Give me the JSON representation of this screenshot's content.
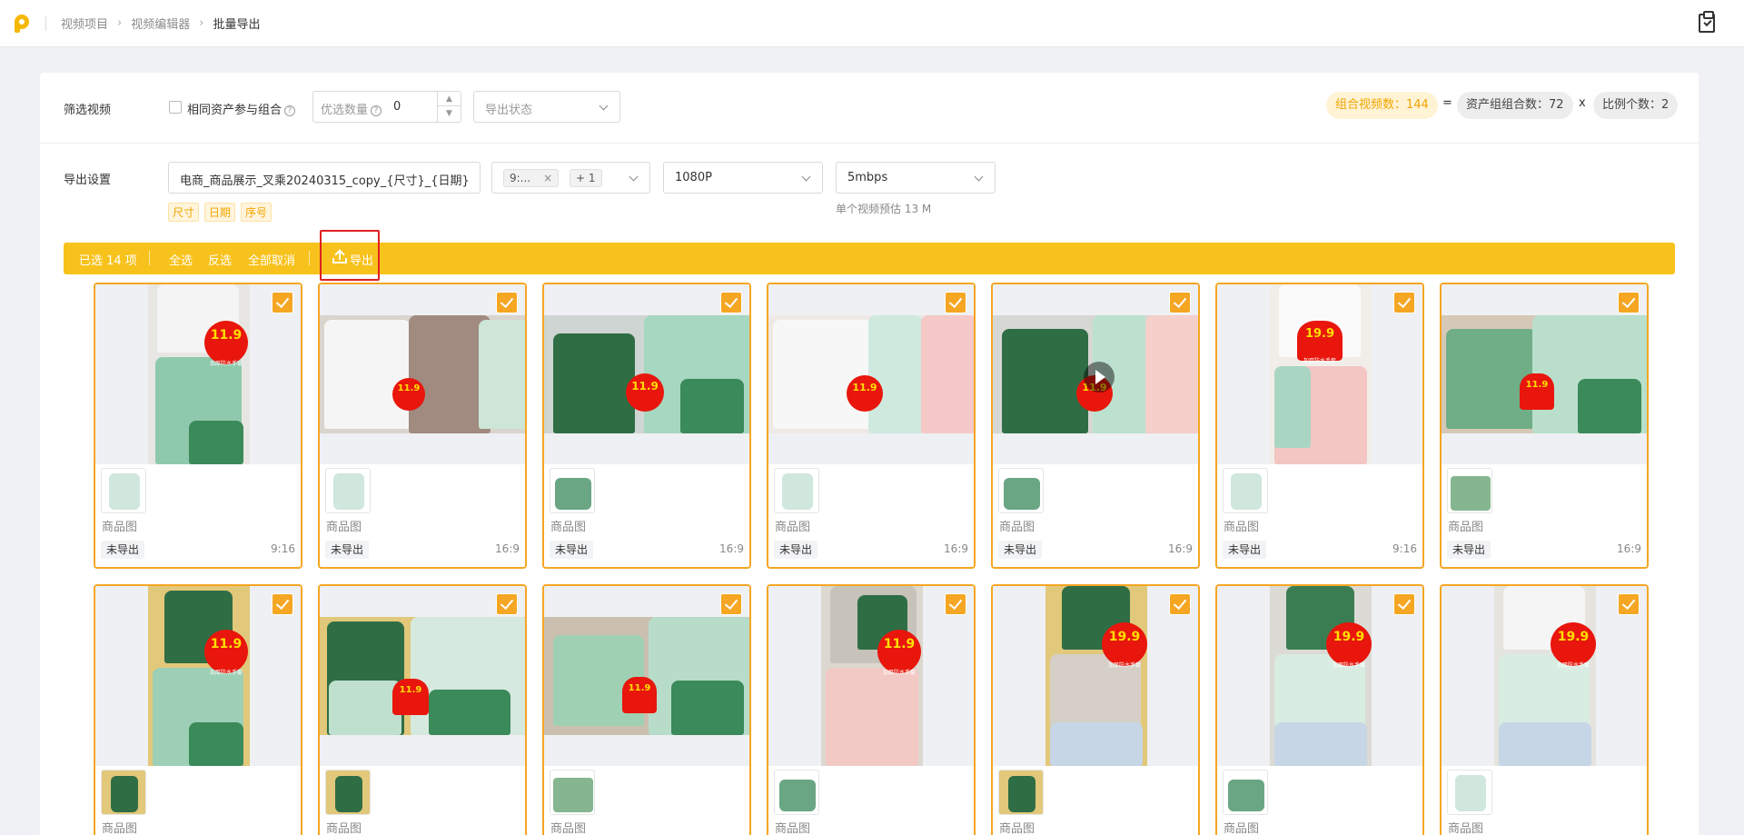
{
  "breadcrumb": [
    "视频项目",
    "视频编辑器",
    "批量导出"
  ],
  "filter": {
    "label": "筛选视频",
    "same_asset_label": "相同资产参与组合",
    "priority_placeholder": "优选数量",
    "priority_value": "0",
    "export_status_placeholder": "导出状态"
  },
  "summary": {
    "combo_videos": "组合视频数：144",
    "eq": "=",
    "asset_groups": "资产组组合数：72",
    "times": "x",
    "ratio_count": "比例个数：2"
  },
  "export_settings": {
    "label": "导出设置",
    "filename": "电商_商品展示_叉乘20240315_copy_{尺寸}_{日期}",
    "tags": [
      "尺寸",
      "日期",
      "序号"
    ],
    "ratio_tag": "9:...",
    "ratio_more": "+ 1",
    "resolution": "1080P",
    "bitrate": "5mbps",
    "estimate": "单个视频预估 13 M"
  },
  "toolbar": {
    "selected": "已选 14 项",
    "select_all": "全选",
    "invert": "反选",
    "cancel_all": "全部取消",
    "export": "导出"
  },
  "colors": {
    "accent": "#f8c21c",
    "card_border": "#f5a623",
    "highlight_box": "#e02020"
  },
  "cards": [
    {
      "label": "商品图",
      "status": "未导出",
      "ratio": "9:16",
      "price": "11.9"
    },
    {
      "label": "商品图",
      "status": "未导出",
      "ratio": "16:9",
      "price": "11.9"
    },
    {
      "label": "商品图",
      "status": "未导出",
      "ratio": "16:9",
      "price": "11.9"
    },
    {
      "label": "商品图",
      "status": "未导出",
      "ratio": "16:9",
      "price": "11.9"
    },
    {
      "label": "商品图",
      "status": "未导出",
      "ratio": "16:9",
      "price": "11.9"
    },
    {
      "label": "商品图",
      "status": "未导出",
      "ratio": "9:16",
      "price": "19.9"
    },
    {
      "label": "商品图",
      "status": "未导出",
      "ratio": "16:9",
      "price": "11.9"
    },
    {
      "label": "商品图",
      "status": "",
      "ratio": "",
      "price": "11.9"
    },
    {
      "label": "商品图",
      "status": "",
      "ratio": "",
      "price": "11.9"
    },
    {
      "label": "商品图",
      "status": "",
      "ratio": "",
      "price": "11.9"
    },
    {
      "label": "商品图",
      "status": "",
      "ratio": "",
      "price": "11.9"
    },
    {
      "label": "商品图",
      "status": "",
      "ratio": "",
      "price": "19.9"
    },
    {
      "label": "商品图",
      "status": "",
      "ratio": "",
      "price": "19.9"
    },
    {
      "label": "商品图",
      "status": "",
      "ratio": "",
      "price": "19.9"
    }
  ]
}
